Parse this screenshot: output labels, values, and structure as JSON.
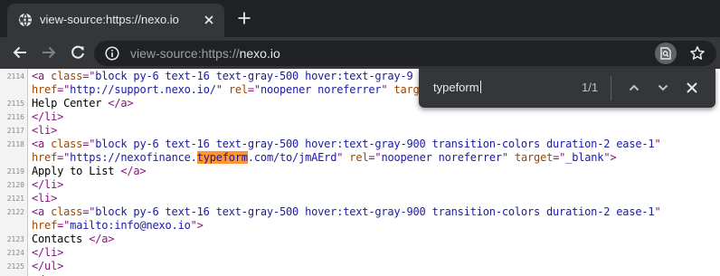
{
  "tab": {
    "title": "view-source:https://nexo.io",
    "favicon_icon": "globe-icon",
    "close_icon": "close-icon"
  },
  "new_tab_icon": "plus-icon",
  "toolbar": {
    "back_icon": "arrow-left-icon",
    "forward_icon": "arrow-right-icon",
    "reload_icon": "reload-icon",
    "site_info_icon": "info-icon",
    "url_scheme": "view-source:https://",
    "url_host": "nexo.io",
    "find_icon": "find-in-page-icon",
    "bookmark_icon": "star-icon"
  },
  "find_bar": {
    "query": "typeform",
    "count": "1/1",
    "prev_icon": "chevron-up-icon",
    "next_icon": "chevron-down-icon",
    "close_icon": "close-icon"
  },
  "source_lines": [
    {
      "n": "2114",
      "parts": [
        [
          "tag",
          "<a "
        ],
        [
          "attr",
          "class"
        ],
        [
          "tag",
          "=\""
        ],
        [
          "val",
          "block py-6 text-16 text-gray-500 hover:text-gray-9"
        ]
      ]
    },
    {
      "n": "",
      "parts": [
        [
          "attr",
          "href"
        ],
        [
          "tag",
          "=\""
        ],
        [
          "val",
          "http://support.nexo.io/"
        ],
        [
          "tag",
          "\" "
        ],
        [
          "attr",
          "rel"
        ],
        [
          "tag",
          "=\""
        ],
        [
          "val",
          "noopener noreferrer"
        ],
        [
          "tag",
          "\" "
        ],
        [
          "attr",
          "targ"
        ]
      ]
    },
    {
      "n": "2115",
      "parts": [
        [
          "text",
          "Help Center "
        ],
        [
          "tag",
          "</a>"
        ]
      ]
    },
    {
      "n": "2116",
      "parts": [
        [
          "tag",
          "</li>"
        ]
      ]
    },
    {
      "n": "2117",
      "parts": [
        [
          "tag",
          "<li>"
        ]
      ]
    },
    {
      "n": "2118",
      "parts": [
        [
          "tag",
          "<a "
        ],
        [
          "attr",
          "class"
        ],
        [
          "tag",
          "=\""
        ],
        [
          "val",
          "block py-6 text-16 text-gray-500 hover:text-gray-900 transition-colors duration-2 ease-1"
        ],
        [
          "tag",
          "\""
        ]
      ]
    },
    {
      "n": "",
      "parts": [
        [
          "attr",
          "href"
        ],
        [
          "tag",
          "=\""
        ],
        [
          "val",
          "https://nexofinance."
        ],
        [
          "match",
          "typeform"
        ],
        [
          "val",
          ".com/to/jmAErd"
        ],
        [
          "tag",
          "\" "
        ],
        [
          "attr",
          "rel"
        ],
        [
          "tag",
          "=\""
        ],
        [
          "val",
          "noopener noreferrer"
        ],
        [
          "tag",
          "\" "
        ],
        [
          "attr",
          "target"
        ],
        [
          "tag",
          "=\""
        ],
        [
          "val",
          "_blank"
        ],
        [
          "tag",
          "\">"
        ]
      ]
    },
    {
      "n": "2119",
      "parts": [
        [
          "text",
          "Apply to List "
        ],
        [
          "tag",
          "</a>"
        ]
      ]
    },
    {
      "n": "2120",
      "parts": [
        [
          "tag",
          "</li>"
        ]
      ]
    },
    {
      "n": "2121",
      "parts": [
        [
          "tag",
          "<li>"
        ]
      ]
    },
    {
      "n": "2122",
      "parts": [
        [
          "tag",
          "<a "
        ],
        [
          "attr",
          "class"
        ],
        [
          "tag",
          "=\""
        ],
        [
          "val",
          "block py-6 text-16 text-gray-500 hover:text-gray-900 transition-colors duration-2 ease-1"
        ],
        [
          "tag",
          "\""
        ]
      ]
    },
    {
      "n": "",
      "parts": [
        [
          "attr",
          "href"
        ],
        [
          "tag",
          "=\""
        ],
        [
          "val",
          "mailto:info@nexo.io"
        ],
        [
          "tag",
          "\">"
        ]
      ]
    },
    {
      "n": "2123",
      "parts": [
        [
          "text",
          "Contacts "
        ],
        [
          "tag",
          "</a>"
        ]
      ]
    },
    {
      "n": "2124",
      "parts": [
        [
          "tag",
          "</li>"
        ]
      ]
    },
    {
      "n": "2125",
      "parts": [
        [
          "tag",
          "</ul>"
        ]
      ]
    },
    {
      "n": "",
      "parts": [
        [
          "tag",
          "</"
        ]
      ]
    }
  ]
}
